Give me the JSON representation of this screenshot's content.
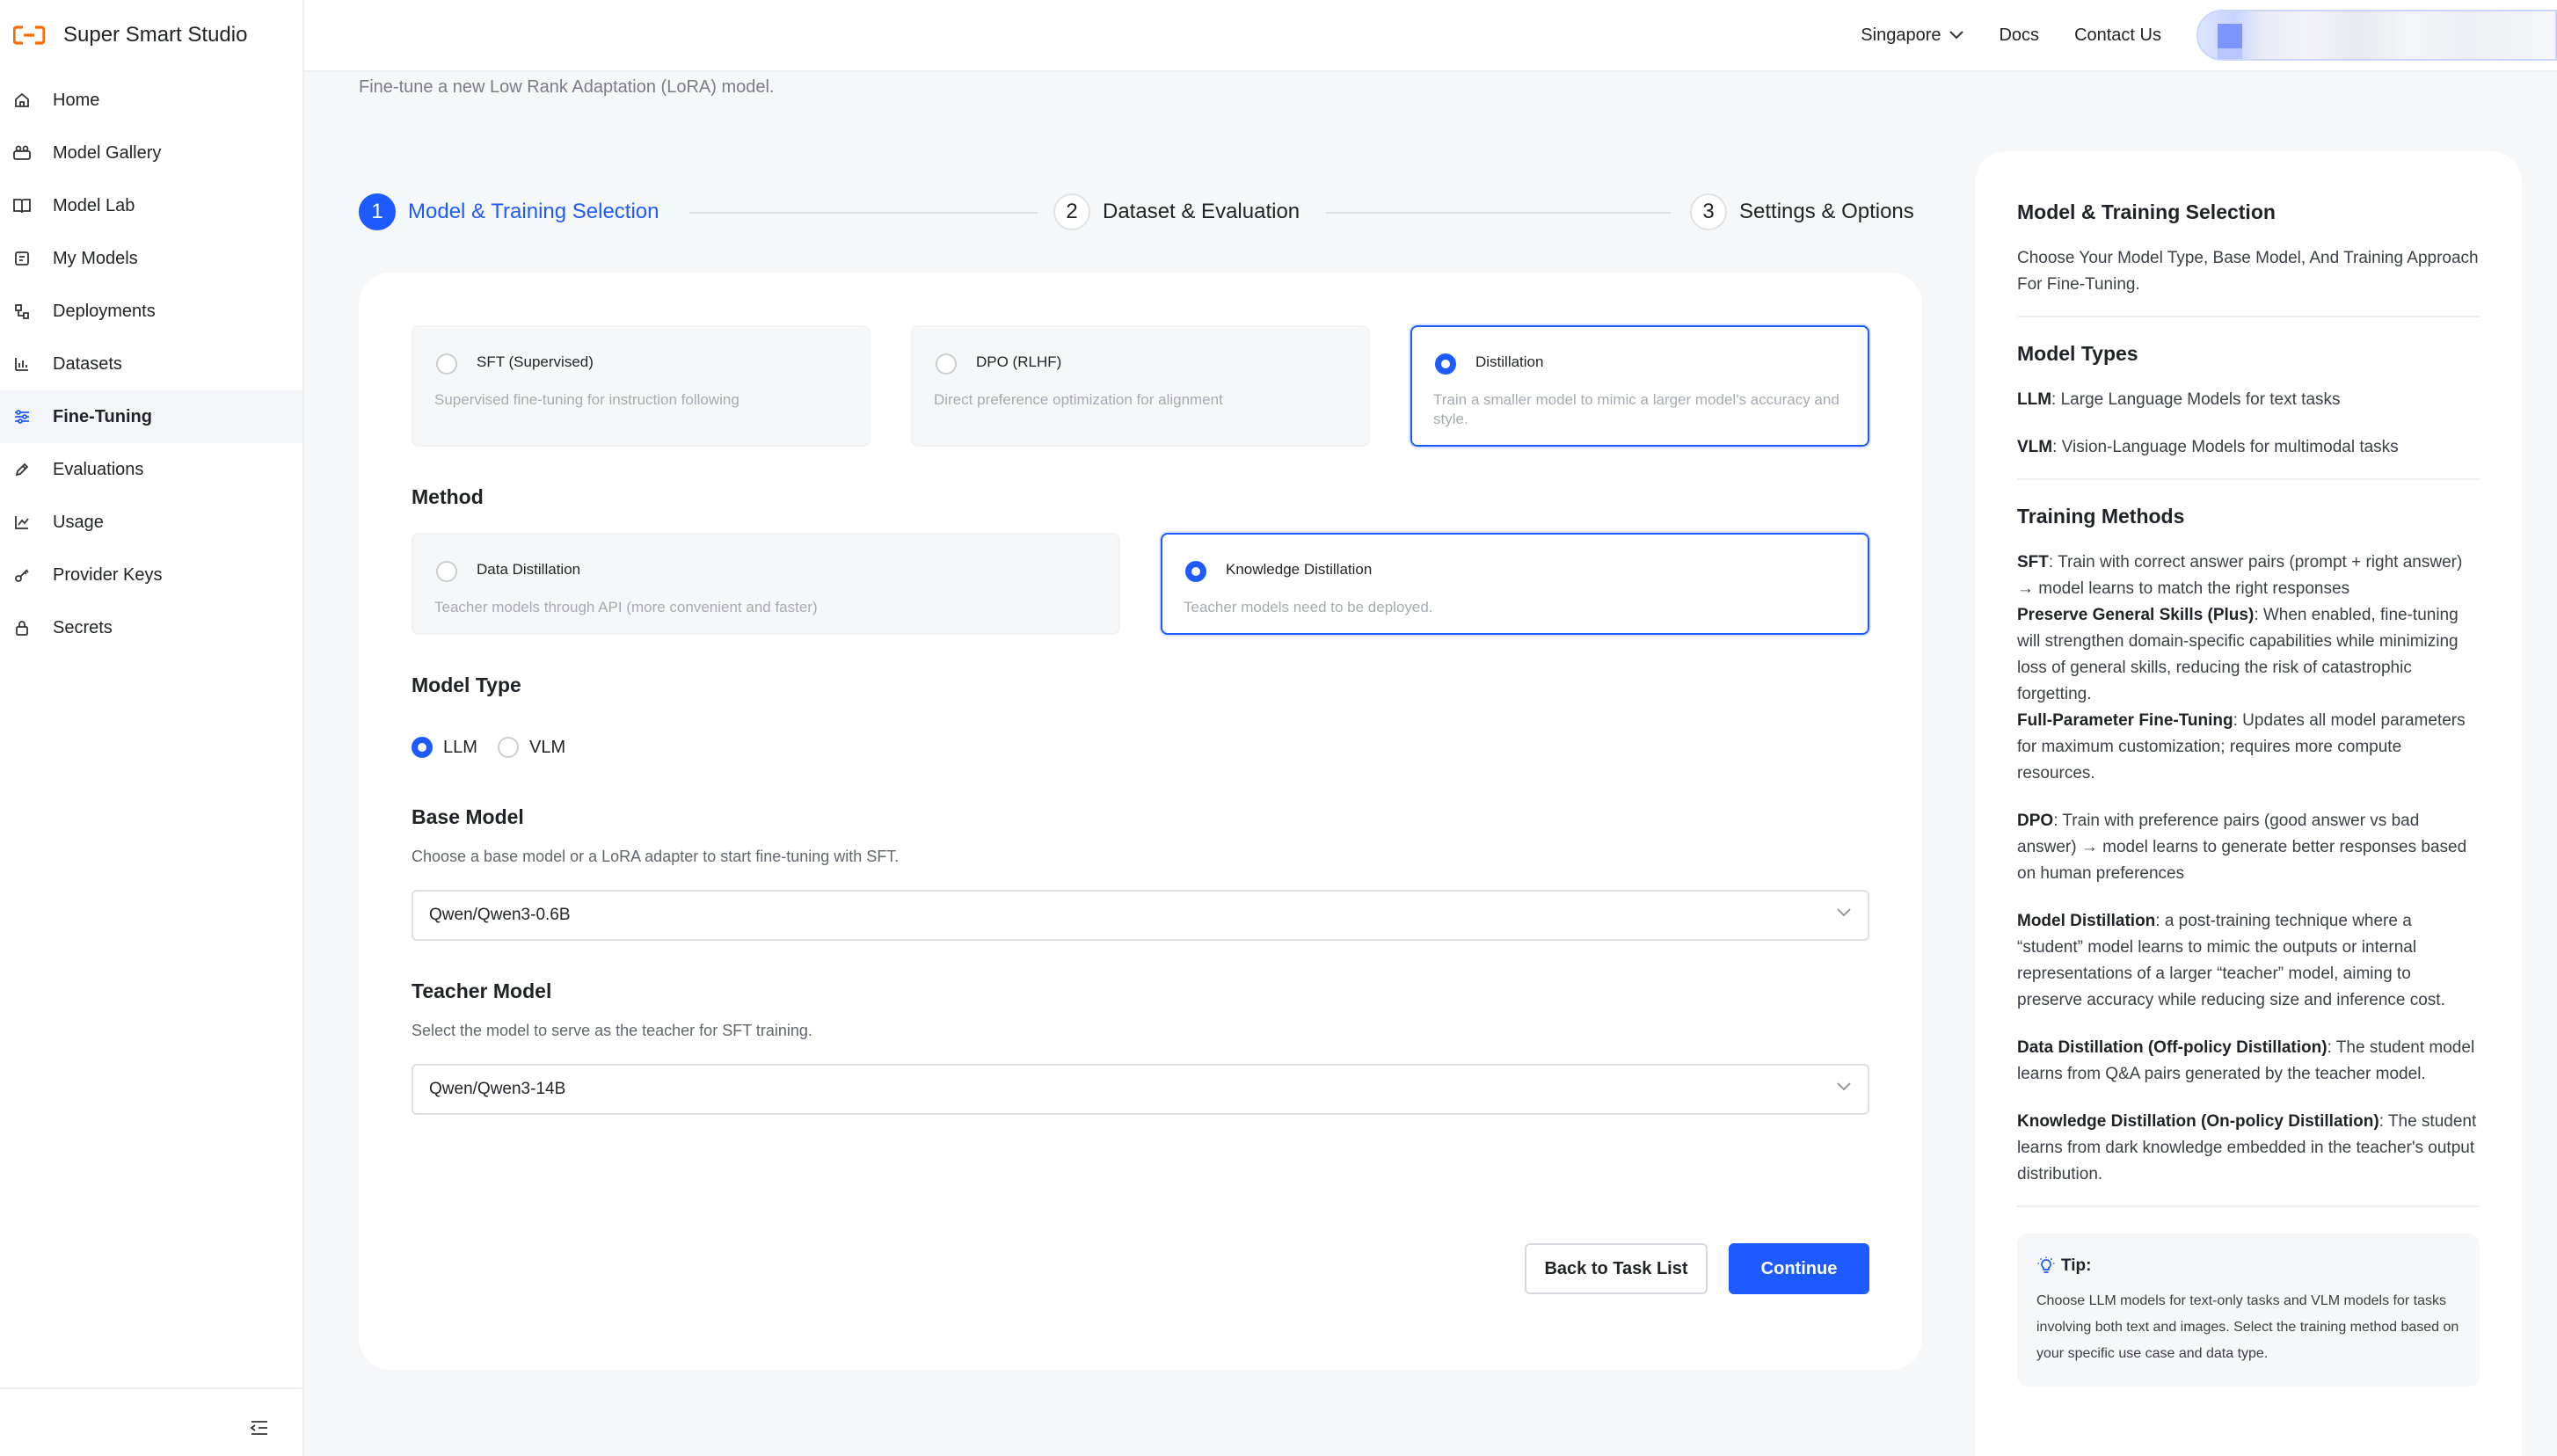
{
  "brand": {
    "name": "Super Smart Studio",
    "accent": "#ff6a00"
  },
  "sidebar": {
    "items": [
      {
        "label": "Home",
        "icon": "home-icon",
        "active": false
      },
      {
        "label": "Model Gallery",
        "icon": "gallery-icon",
        "active": false
      },
      {
        "label": "Model Lab",
        "icon": "lab-icon",
        "active": false
      },
      {
        "label": "My Models",
        "icon": "models-icon",
        "active": false
      },
      {
        "label": "Deployments",
        "icon": "deployments-icon",
        "active": false
      },
      {
        "label": "Datasets",
        "icon": "datasets-icon",
        "active": false
      },
      {
        "label": "Fine-Tuning",
        "icon": "sliders-icon",
        "active": true
      },
      {
        "label": "Evaluations",
        "icon": "pencil-icon",
        "active": false
      },
      {
        "label": "Usage",
        "icon": "chart-icon",
        "active": false
      },
      {
        "label": "Provider Keys",
        "icon": "key-icon",
        "active": false
      },
      {
        "label": "Secrets",
        "icon": "lock-icon",
        "active": false
      }
    ]
  },
  "topbar": {
    "region": "Singapore",
    "docs": "Docs",
    "contact": "Contact Us"
  },
  "page": {
    "subtitle": "Fine-tune a new Low Rank Adaptation (LoRA) model."
  },
  "steps": [
    {
      "num": "1",
      "label": "Model & Training Selection",
      "active": true
    },
    {
      "num": "2",
      "label": "Dataset & Evaluation",
      "active": false
    },
    {
      "num": "3",
      "label": "Settings & Options",
      "active": false
    }
  ],
  "training": {
    "options": [
      {
        "title": "SFT (Supervised)",
        "desc": "Supervised fine-tuning for instruction following",
        "selected": false
      },
      {
        "title": "DPO (RLHF)",
        "desc": "Direct preference optimization for alignment",
        "selected": false
      },
      {
        "title": "Distillation",
        "desc": "Train a smaller model to mimic a larger model's accuracy and style.",
        "selected": true
      }
    ]
  },
  "method": {
    "title": "Method",
    "options": [
      {
        "title": "Data Distillation",
        "desc": "Teacher models through API (more convenient and faster)",
        "selected": false
      },
      {
        "title": "Knowledge Distillation",
        "desc": "Teacher models need to be deployed.",
        "selected": true
      }
    ]
  },
  "model_type": {
    "title": "Model Type",
    "options": [
      {
        "label": "LLM",
        "checked": true
      },
      {
        "label": "VLM",
        "checked": false
      }
    ]
  },
  "base_model": {
    "title": "Base Model",
    "desc": "Choose a base model or a LoRA adapter to start fine-tuning with SFT.",
    "value": "Qwen/Qwen3-0.6B"
  },
  "teacher_model": {
    "title": "Teacher Model",
    "desc": "Select the model to serve as the teacher for SFT training.",
    "value": "Qwen/Qwen3-14B"
  },
  "actions": {
    "back": "Back to Task List",
    "continue": "Continue"
  },
  "info": {
    "title": "Model & Training Selection",
    "intro": "Choose Your Model Type, Base Model, And Training Approach For Fine-Tuning.",
    "types_title": "Model Types",
    "llm_term": "LLM",
    "llm_text": ": Large Language Models for text tasks",
    "vlm_term": "VLM",
    "vlm_text": ": Vision-Language Models for multimodal tasks",
    "methods_title": "Training Methods",
    "sft_term": "SFT",
    "sft_text": ": Train with correct answer pairs (prompt + right answer) → model learns to match the right responses",
    "plus_term": "Preserve General Skills (Plus)",
    "plus_text": ": When enabled, fine-tuning will strengthen domain-specific capabilities while minimizing loss of general skills, reducing the risk of catastrophic forgetting.",
    "full_term": "Full-Parameter Fine-Tuning",
    "full_text": ": Updates all model parameters for maximum customization; requires more compute resources.",
    "dpo_term": "DPO",
    "dpo_text": ": Train with preference pairs (good answer vs bad answer) → model learns to generate better responses based on human preferences",
    "distill_term": "Model Distillation",
    "distill_text": ": a post-training technique where a “student” model learns to mimic the outputs or internal representations of a larger “teacher” model, aiming to preserve accuracy while reducing size and inference cost.",
    "data_distill_term": "Data Distillation (Off-policy Distillation)",
    "data_distill_text": ": The student model learns from Q&A pairs generated by the teacher model.",
    "know_distill_term": "Knowledge Distillation (On-policy Distillation)",
    "know_distill_text": ": The student learns from dark knowledge embedded in the teacher's output distribution.",
    "tip_title": "Tip:",
    "tip_text": "Choose LLM models for text-only tasks and VLM models for tasks involving both text and images. Select the training method based on your specific use case and data type."
  }
}
